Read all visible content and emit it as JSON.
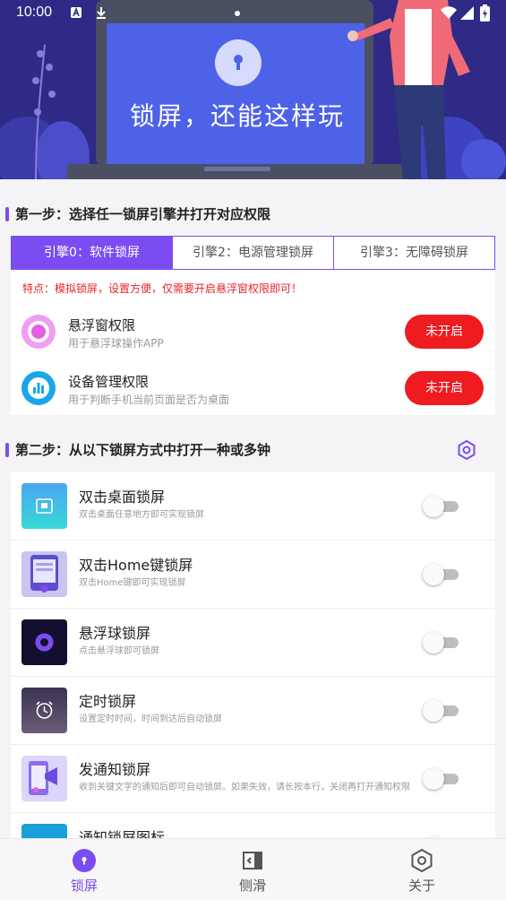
{
  "status_bar": {
    "time": "10:00"
  },
  "banner": {
    "text": "锁屏，还能这样玩"
  },
  "step1": {
    "title": "第一步：选择任一锁屏引擎并打开对应权限",
    "tabs": [
      {
        "label": "引擎0：软件锁屏",
        "active": true
      },
      {
        "label": "引擎2：电源管理锁屏",
        "active": false
      },
      {
        "label": "引擎3：无障碍锁屏",
        "active": false
      }
    ],
    "tip": "特点：模拟锁屏，设置方便，仅需要开启悬浮窗权限即可！",
    "permissions": [
      {
        "title": "悬浮窗权限",
        "desc": "用于悬浮球操作APP",
        "button": "未开启",
        "icon": "floating-window-icon"
      },
      {
        "title": "设备管理权限",
        "desc": "用于判断手机当前页面是否为桌面",
        "button": "未开启",
        "icon": "device-admin-icon"
      }
    ]
  },
  "step2": {
    "title": "第二步：从以下锁屏方式中打开一种或多钟",
    "settings_icon": "hexagon-settings-icon",
    "methods": [
      {
        "title": "双击桌面锁屏",
        "desc": "双击桌面任意地方即可实现锁屏",
        "enabled": false
      },
      {
        "title": "双击Home键锁屏",
        "desc": "双击Home键即可实现锁屏",
        "enabled": false
      },
      {
        "title": "悬浮球锁屏",
        "desc": "点击悬浮球即可锁屏",
        "enabled": false
      },
      {
        "title": "定时锁屏",
        "desc": "设置定时时间，时间到达后自动锁屏",
        "enabled": false
      },
      {
        "title": "发通知锁屏",
        "desc": "收到关键文字的通知后即可自动锁屏。如果失效，请长按本行，关闭再打开通知权限",
        "enabled": false
      },
      {
        "title": "通知锁屏图标",
        "desc": "",
        "enabled": false
      }
    ]
  },
  "bottom_nav": [
    {
      "label": "锁屏",
      "active": true,
      "icon": "lock-screen-icon"
    },
    {
      "label": "侧滑",
      "active": false,
      "icon": "side-swipe-icon"
    },
    {
      "label": "关于",
      "active": false,
      "icon": "about-hexagon-icon"
    }
  ],
  "colors": {
    "accent": "#7b4cf2",
    "danger": "#ee1b20",
    "banner_bg": "#2f2a85"
  }
}
